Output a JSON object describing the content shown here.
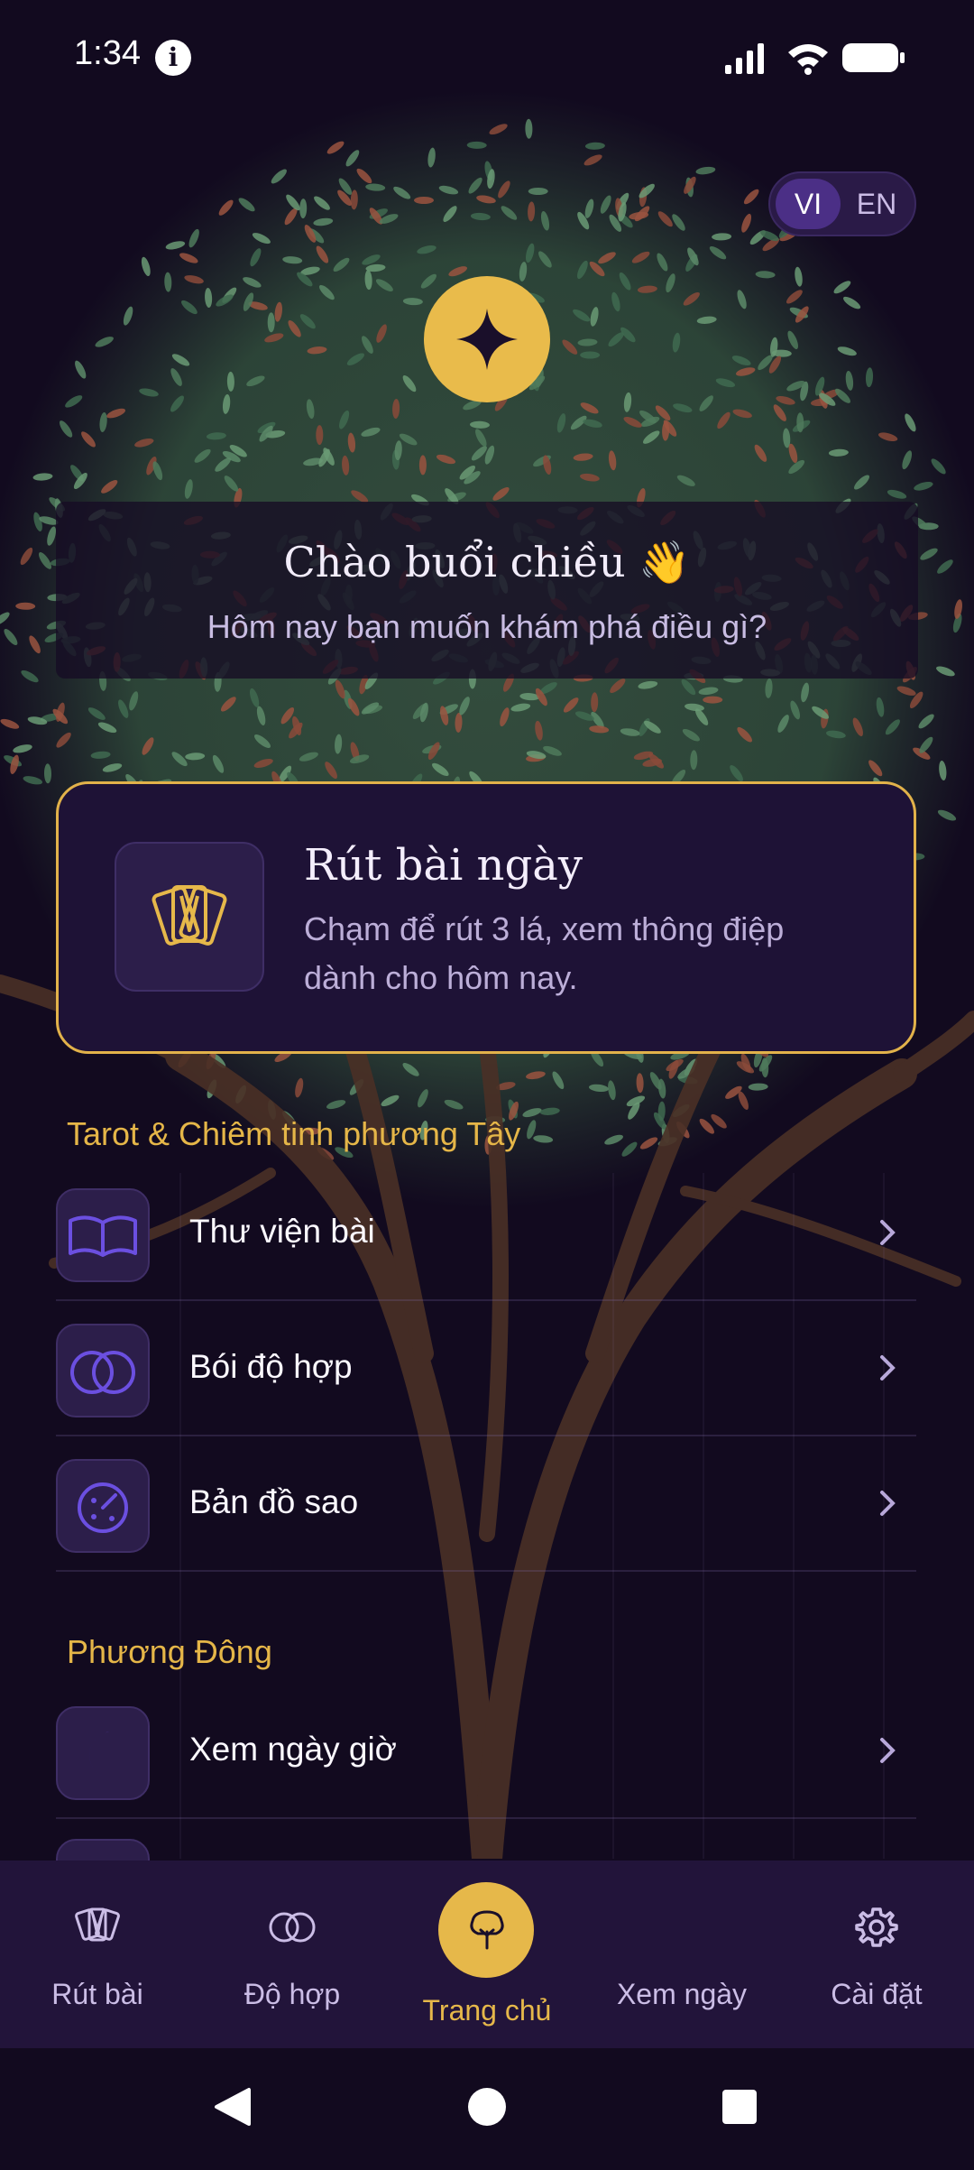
{
  "status_bar": {
    "time": "1:34"
  },
  "language_toggle": {
    "vi": "VI",
    "en": "EN",
    "selected": "VI"
  },
  "greeting": {
    "title": "Chào buổi chiều 👋",
    "subtitle": "Hôm nay bạn muốn khám phá điều gì?"
  },
  "daily_card": {
    "title": "Rút bài ngày",
    "description": "Chạm để rút 3 lá, xem thông điệp dành cho hôm nay."
  },
  "sections": {
    "western": {
      "title": "Tarot & Chiêm tinh phương Tây",
      "items": [
        {
          "label": "Thư viện bài",
          "icon": "book-icon"
        },
        {
          "label": "Bói độ hợp",
          "icon": "rings-icon"
        },
        {
          "label": "Bản đồ sao",
          "icon": "star-chart-icon"
        }
      ]
    },
    "eastern": {
      "title": "Phương Đông",
      "items": [
        {
          "label": "Xem ngày giờ",
          "icon": "moon-icon"
        }
      ]
    }
  },
  "bottom_nav": {
    "tabs": [
      {
        "label": "Rút bài",
        "icon": "cards-icon"
      },
      {
        "label": "Độ hợp",
        "icon": "rings-icon"
      },
      {
        "label": "Trang chủ",
        "icon": "tree-icon",
        "active": true
      },
      {
        "label": "Xem ngày",
        "icon": "moon-icon"
      },
      {
        "label": "Cài đặt",
        "icon": "gear-icon"
      }
    ]
  },
  "colors": {
    "background": "#120a1f",
    "accent_gold": "#e6b84a",
    "card_bg": "#1e1236",
    "icon_purple": "#6b4fe0"
  }
}
